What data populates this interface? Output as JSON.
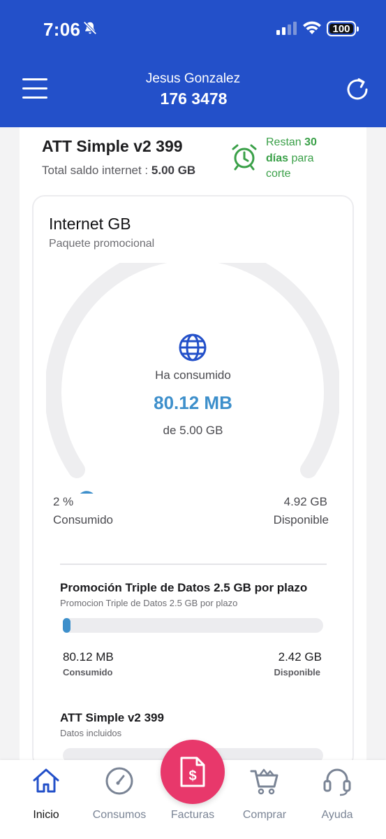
{
  "status_bar": {
    "time": "7:06",
    "battery": "100"
  },
  "header": {
    "user_name": "Jesus Gonzalez",
    "phone_masked": "",
    "phone_visible": "176 3478"
  },
  "plan": {
    "name": "ATT Simple v2 399",
    "total_label": "Total saldo internet :",
    "total_value": "5.00 GB",
    "days_prefix": "Restan",
    "days_number": "30",
    "days_word": "días",
    "days_suffix": "para corte"
  },
  "internet": {
    "title": "Internet GB",
    "subtitle": "Paquete promocional",
    "consumed_label": "Ha consumido",
    "consumed_value": "80.12 MB",
    "of_total": "de 5.00 GB",
    "percent": "2 %",
    "percent_label": "Consumido",
    "available": "4.92 GB",
    "available_label": "Disponible",
    "consumed_fraction": 0.02
  },
  "packages": [
    {
      "title": "Promoción Triple de Datos 2.5 GB por plazo",
      "subtitle": "Promocion Triple de Datos 2.5 GB por plazo",
      "used": "80.12 MB",
      "used_label": "Consumido",
      "available": "2.42 GB",
      "available_label": "Disponible",
      "fraction": 0.03
    },
    {
      "title": "ATT Simple v2 399",
      "subtitle": "Datos incluidos"
    }
  ],
  "nav": {
    "items": [
      {
        "label": "Inicio",
        "icon": "home-icon"
      },
      {
        "label": "Consumos",
        "icon": "gauge-icon"
      },
      {
        "label": "Facturas",
        "icon": "invoice-icon"
      },
      {
        "label": "Comprar",
        "icon": "cart-icon"
      },
      {
        "label": "Ayuda",
        "icon": "headset-icon"
      }
    ]
  },
  "colors": {
    "header_blue": "#2350c9",
    "accent_blue": "#3d8fcb",
    "success_green": "#3aa048",
    "fab_pink": "#e8386b"
  }
}
